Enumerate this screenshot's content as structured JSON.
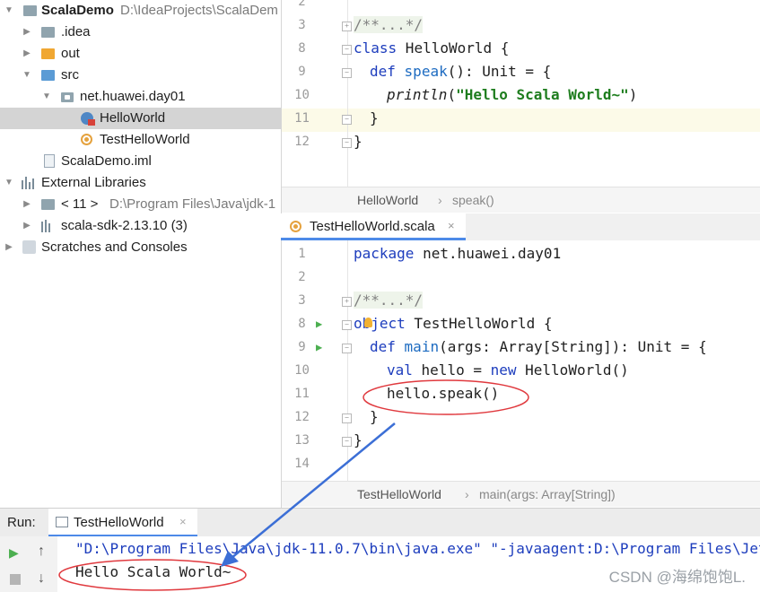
{
  "project_tree": {
    "root": {
      "label": "ScalaDemo",
      "path": "D:\\IdeaProjects\\ScalaDem"
    },
    "items": [
      {
        "label": ".idea"
      },
      {
        "label": "out"
      },
      {
        "label": "src"
      },
      {
        "label": "net.huawei.day01"
      },
      {
        "label": "HelloWorld"
      },
      {
        "label": "TestHelloWorld"
      },
      {
        "label": "ScalaDemo.iml"
      },
      {
        "label": "External Libraries"
      },
      {
        "label": "< 11 >",
        "path": "D:\\Program Files\\Java\\jdk-1"
      },
      {
        "label": "scala-sdk-2.13.10 (3)"
      },
      {
        "label": "Scratches and Consoles"
      }
    ]
  },
  "editor_top": {
    "lines": [
      {
        "num": "2"
      },
      {
        "num": "3",
        "text": "/**...*/"
      },
      {
        "num": "8",
        "kw": "class",
        "rest": " HelloWorld {"
      },
      {
        "num": "9",
        "kw": "def",
        "fn": "speak",
        "rest": "(): Unit = {"
      },
      {
        "num": "10",
        "fn": "println",
        "open": "(",
        "str": "\"Hello Scala World~\"",
        "close": ")"
      },
      {
        "num": "11",
        "text": "}"
      },
      {
        "num": "12",
        "text": "}"
      }
    ],
    "breadcrumb": {
      "a": "HelloWorld",
      "sep": "›",
      "b": "speak()"
    }
  },
  "editor_tab": {
    "label": "TestHelloWorld.scala",
    "close": "×"
  },
  "editor_bottom": {
    "lines": [
      {
        "num": "1",
        "kw": "package",
        "rest": " net.huawei.day01"
      },
      {
        "num": "2"
      },
      {
        "num": "3",
        "text": "/**...*/"
      },
      {
        "num": "8",
        "kw": "object",
        "rest": " TestHelloWorld {"
      },
      {
        "num": "9",
        "kw": "def",
        "fn": "main",
        "rest": "(args: Array[String]): Unit = {"
      },
      {
        "num": "10",
        "kw": "val",
        "mid": " hello = ",
        "kw2": "new",
        "rest": " HelloWorld()"
      },
      {
        "num": "11",
        "text": "hello.speak()"
      },
      {
        "num": "12",
        "text": "}"
      },
      {
        "num": "13",
        "text": "}"
      },
      {
        "num": "14"
      }
    ],
    "breadcrumb": {
      "a": "TestHelloWorld",
      "sep": "›",
      "b": "main(args: Array[String])"
    }
  },
  "run_panel": {
    "label": "Run:",
    "tab": "TestHelloWorld",
    "tab_close": "×",
    "console": [
      "\"D:\\Program Files\\Java\\jdk-11.0.7\\bin\\java.exe\" \"-javaagent:D:\\Program Files\\Jet",
      "Hello Scala World~"
    ],
    "watermark": "CSDN @海绵饱饱L."
  },
  "colors": {
    "keyword": "#1d3dbd",
    "string": "#1e7d1e",
    "annotation": "#e0393e",
    "accent": "#4d8ae8"
  }
}
